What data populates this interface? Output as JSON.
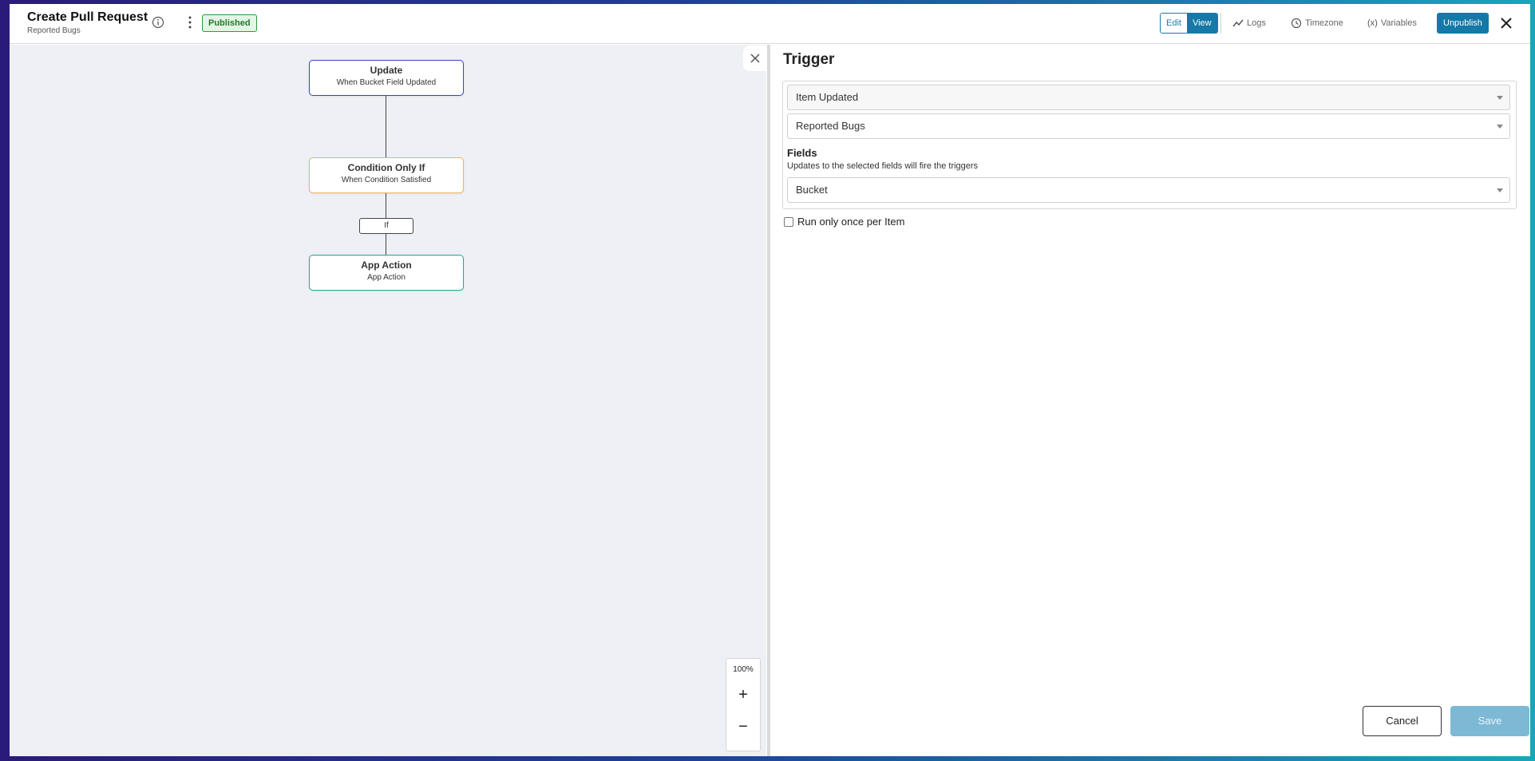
{
  "header": {
    "title": "Create Pull Request",
    "subtitle": "Reported Bugs",
    "status_badge": "Published",
    "mode_edit": "Edit",
    "mode_view": "View",
    "logs": "Logs",
    "timezone": "Timezone",
    "variables": "Variables",
    "unpublish": "Unpublish"
  },
  "canvas": {
    "nodes": [
      {
        "title": "Update",
        "subtitle": "When Bucket Field Updated"
      },
      {
        "title": "Condition Only If",
        "subtitle": "When Condition Satisfied"
      },
      {
        "title": "App Action",
        "subtitle": "App Action"
      }
    ],
    "branch_label": "If",
    "zoom_level": "100%",
    "zoom_in": "+",
    "zoom_out": "−"
  },
  "panel": {
    "title": "Trigger",
    "event_select": "Item Updated",
    "source_select": "Reported Bugs",
    "fields_label": "Fields",
    "fields_help": "Updates to the selected fields will fire the triggers",
    "fields_select": "Bucket",
    "run_once_label": "Run only once per Item",
    "cancel": "Cancel",
    "save": "Save"
  },
  "colors": {
    "accent": "#1479a6",
    "published_green": "#2e9b3a",
    "node_update_border": "#3a45b8",
    "node_condition_border": "#f0b35a",
    "node_action_border": "#1da89a"
  }
}
